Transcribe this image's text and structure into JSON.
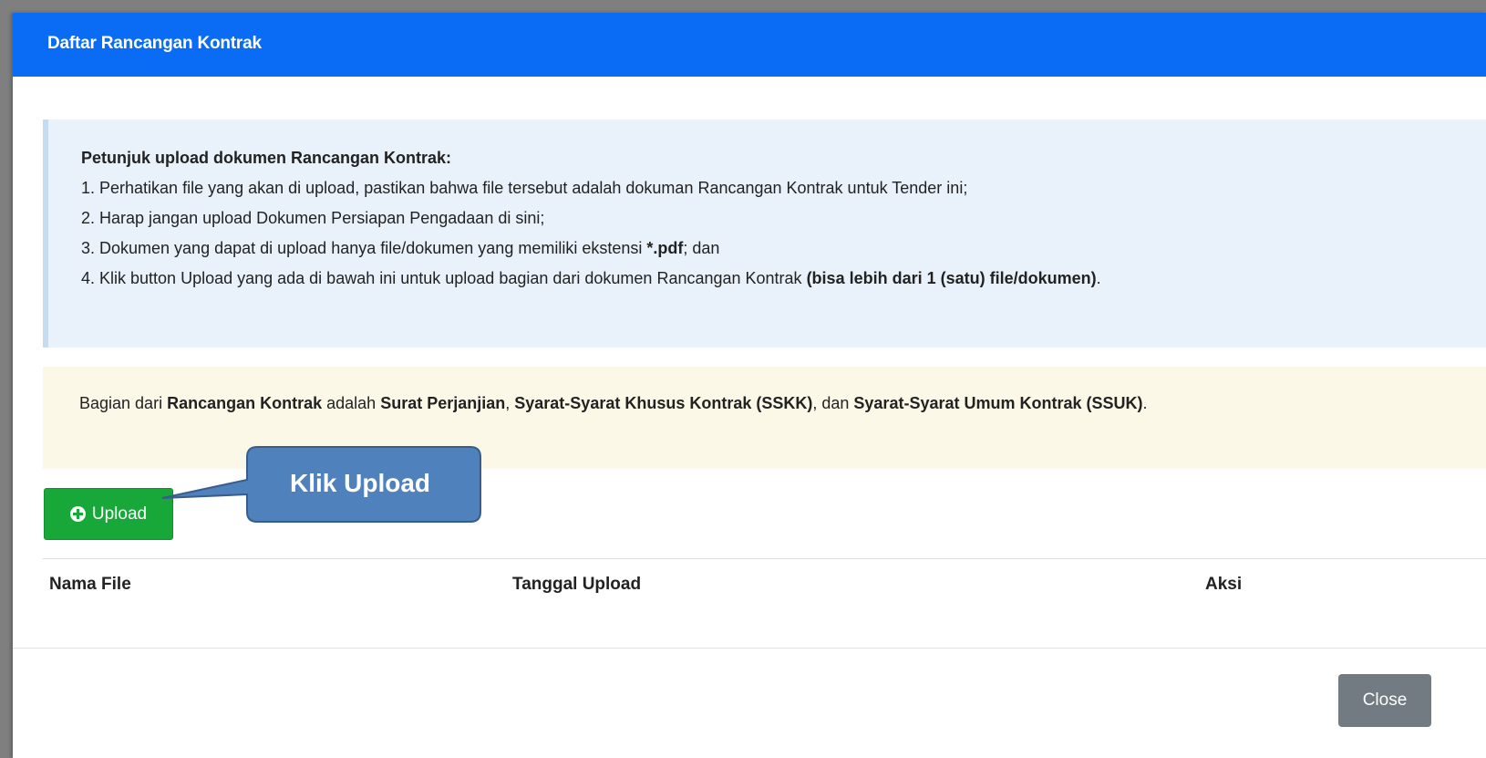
{
  "modal": {
    "title": "Daftar Rancangan Kontrak"
  },
  "info": {
    "heading": "Petunjuk upload dokumen Rancangan Kontrak:",
    "line1": "1. Perhatikan file yang akan di upload, pastikan bahwa file tersebut adalah dokuman Rancangan Kontrak untuk Tender ini;",
    "line2": "2. Harap jangan upload Dokumen Persiapan Pengadaan di sini;",
    "line3_prefix": "3. Dokumen yang dapat di upload hanya file/dokumen yang memiliki ekstensi ",
    "line3_ext": "*.pdf",
    "line3_suffix": "; dan",
    "line4_prefix": "4. Klik button Upload yang ada di bawah ini untuk upload bagian dari dokumen Rancangan Kontrak ",
    "line4_bold": "(bisa lebih dari 1 (satu) file/dokumen)",
    "line4_suffix": "."
  },
  "note": {
    "t1": "Bagian dari ",
    "b1": "Rancangan Kontrak",
    "t2": " adalah ",
    "b2": "Surat Perjanjian",
    "t3": ", ",
    "b3": "Syarat-Syarat Khusus Kontrak (SSKK)",
    "t4": ", dan ",
    "b4": "Syarat-Syarat Umum Kontrak (SSUK)",
    "t5": "."
  },
  "upload_button": {
    "label": "Upload",
    "icon": "plus-circle-icon"
  },
  "callout": {
    "label": "Klik Upload",
    "fill": "#4f81bd",
    "stroke": "#385d8a"
  },
  "table": {
    "columns": [
      "Nama File",
      "Tanggal Upload",
      "Aksi"
    ]
  },
  "footer": {
    "close_label": "Close"
  },
  "colors": {
    "header": "#0a6cf5",
    "upload": "#18a83a",
    "close": "#737b82"
  }
}
